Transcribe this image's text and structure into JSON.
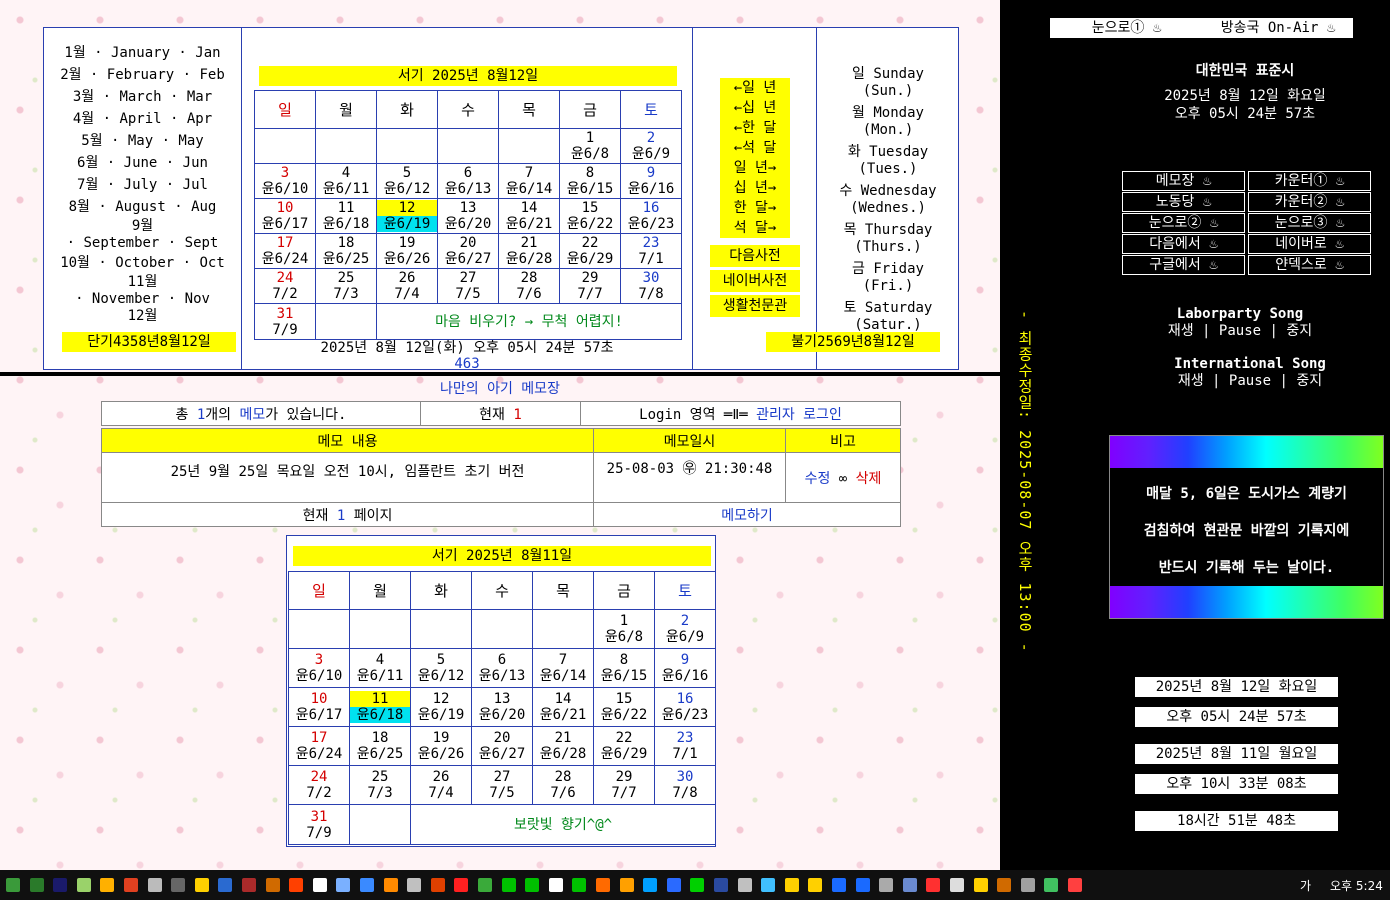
{
  "top": {
    "months": [
      "1월 · January · Jan",
      "2월 · February · Feb",
      "3월 · March · Mar",
      "4월 · April · Apr",
      "5월 · May · May",
      "6월 · June · Jun",
      "7월 · July · Jul",
      "8월 · August · Aug",
      "9월",
      "· September · Sept",
      "10월 · October · Oct",
      "11월",
      "· November · Nov",
      "12월"
    ],
    "dangi": "단기4358년8월12일",
    "bulgi": "불기2569년8월12일",
    "cal_title": "서기 2025년 8월12일",
    "weekday_headers": [
      "일",
      "월",
      "화",
      "수",
      "목",
      "금",
      "토"
    ],
    "rows": [
      [
        [
          "",
          ""
        ],
        [
          "",
          ""
        ],
        [
          "",
          ""
        ],
        [
          "",
          ""
        ],
        [
          "",
          ""
        ],
        [
          "1",
          "윤6/8"
        ],
        [
          "2",
          "윤6/9"
        ]
      ],
      [
        [
          "3",
          "윤6/10"
        ],
        [
          "4",
          "윤6/11"
        ],
        [
          "5",
          "윤6/12"
        ],
        [
          "6",
          "윤6/13"
        ],
        [
          "7",
          "윤6/14"
        ],
        [
          "8",
          "윤6/15"
        ],
        [
          "9",
          "윤6/16"
        ]
      ],
      [
        [
          "10",
          "윤6/17"
        ],
        [
          "11",
          "윤6/18"
        ],
        [
          "12",
          "윤6/19"
        ],
        [
          "13",
          "윤6/20"
        ],
        [
          "14",
          "윤6/21"
        ],
        [
          "15",
          "윤6/22"
        ],
        [
          "16",
          "윤6/23"
        ]
      ],
      [
        [
          "17",
          "윤6/24"
        ],
        [
          "18",
          "윤6/25"
        ],
        [
          "19",
          "윤6/26"
        ],
        [
          "20",
          "윤6/27"
        ],
        [
          "21",
          "윤6/28"
        ],
        [
          "22",
          "윤6/29"
        ],
        [
          "23",
          "7/1"
        ]
      ],
      [
        [
          "24",
          "7/2"
        ],
        [
          "25",
          "7/3"
        ],
        [
          "26",
          "7/4"
        ],
        [
          "27",
          "7/5"
        ],
        [
          "28",
          "7/6"
        ],
        [
          "29",
          "7/7"
        ],
        [
          "30",
          "7/8"
        ]
      ]
    ],
    "last_row_day": [
      "31",
      "7/9"
    ],
    "message": "마음 비우기? → 무척 어렵지!",
    "clock": "2025년 8월 12일(화) 오후 05시 24분 57초",
    "counter": "463",
    "nav": [
      "←일 년",
      "←십 년",
      "←한 달",
      "←석 달",
      "일 년→",
      "십 년→",
      "한 달→",
      "석 달→"
    ],
    "dict_buttons": [
      "다음사전",
      "네이버사전",
      "생활천문관"
    ],
    "days": [
      "일 Sunday",
      "(Sun.)",
      "월 Monday",
      "(Mon.)",
      "화 Tuesday",
      "(Tues.)",
      "수 Wednesday",
      "(Wednes.)",
      "목 Thursday",
      "(Thurs.)",
      "금 Friday",
      "(Fri.)",
      "토 Saturday",
      "(Satur.)"
    ]
  },
  "memo": {
    "title": "나만의 아기 메모장",
    "count_prefix": "총 ",
    "count": "1",
    "count_mid": "개의 ",
    "count_word": "메모",
    "count_suffix": "가 있습니다.",
    "current_label": "현재 ",
    "current": "1",
    "login_label": "Login 영역 ═Ⅱ═ ",
    "login_link": "관리자 로그인",
    "col_content": "메모 내용",
    "col_date": "메모일시",
    "col_note": "비고",
    "content": "25년 9월 25일 목요일 오전 10시, 임플란트 초기 버전",
    "date": "25-08-03 ㉾ 21:30:48",
    "edit": "수정",
    "sep": "∞",
    "delete": "삭제",
    "page_prefix": "현재 ",
    "page": "1",
    "page_suffix": " 페이지",
    "write": "메모하기"
  },
  "cal2": {
    "title": "서기 2025년 8월11일",
    "weekday_headers": [
      "일",
      "월",
      "화",
      "수",
      "목",
      "금",
      "토"
    ],
    "rows": [
      [
        [
          "",
          ""
        ],
        [
          "",
          ""
        ],
        [
          "",
          ""
        ],
        [
          "",
          ""
        ],
        [
          "",
          ""
        ],
        [
          "1",
          "윤6/8"
        ],
        [
          "2",
          "윤6/9"
        ]
      ],
      [
        [
          "3",
          "윤6/10"
        ],
        [
          "4",
          "윤6/11"
        ],
        [
          "5",
          "윤6/12"
        ],
        [
          "6",
          "윤6/13"
        ],
        [
          "7",
          "윤6/14"
        ],
        [
          "8",
          "윤6/15"
        ],
        [
          "9",
          "윤6/16"
        ]
      ],
      [
        [
          "10",
          "윤6/17"
        ],
        [
          "11",
          "윤6/18"
        ],
        [
          "12",
          "윤6/19"
        ],
        [
          "13",
          "윤6/20"
        ],
        [
          "14",
          "윤6/21"
        ],
        [
          "15",
          "윤6/22"
        ],
        [
          "16",
          "윤6/23"
        ]
      ],
      [
        [
          "17",
          "윤6/24"
        ],
        [
          "18",
          "윤6/25"
        ],
        [
          "19",
          "윤6/26"
        ],
        [
          "20",
          "윤6/27"
        ],
        [
          "21",
          "윤6/28"
        ],
        [
          "22",
          "윤6/29"
        ],
        [
          "23",
          "7/1"
        ]
      ],
      [
        [
          "24",
          "7/2"
        ],
        [
          "25",
          "7/3"
        ],
        [
          "26",
          "7/4"
        ],
        [
          "27",
          "7/5"
        ],
        [
          "28",
          "7/6"
        ],
        [
          "29",
          "7/7"
        ],
        [
          "30",
          "7/8"
        ]
      ]
    ],
    "last_row_day": [
      "31",
      "7/9"
    ],
    "message": "보랏빛 향기^@^"
  },
  "sidebar": {
    "tab1": "눈으로① ♨",
    "tab2": "방송국 On-Air ♨",
    "std_time": "대한민국 표준시",
    "date": "2025년 8월 12일 화요일",
    "time": "오후 05시 24분 57초",
    "links": [
      "메모장 ♨",
      "카운터① ♨",
      "노동당 ♨",
      "카운터② ♨",
      "눈으로② ♨",
      "눈으로③ ♨",
      "다음에서 ♨",
      "네이버로 ♨",
      "구글에서 ♨",
      "얀덱스로 ♨"
    ],
    "song1_title": "Laborparty Song",
    "song2_title": "International Song",
    "play": "재생",
    "pause": "Pause",
    "stop": "중지",
    "bar": "|",
    "notice": [
      "매달 5, 6일은 도시가스 계량기",
      "검침하여 현관문 바깥의 기록지에",
      "반드시 기록해 두는 날이다."
    ],
    "modified": "- 최종수정일: 2025-08-07 오후 13:00 -",
    "box1": "2025년 8월 12일 화요일",
    "box2": "오후 05시 24분 57초",
    "box3": "2025년 8월 11일 월요일",
    "box4": "오후 10시 33분 08초",
    "box5": "18시간 51분 48초"
  },
  "taskbar": {
    "ime": "가",
    "clock": "오후 5:24",
    "icon_colors": [
      "#3a9a3a",
      "#2a7a2a",
      "#1a1a6a",
      "#9ad26a",
      "#ffb000",
      "#e04020",
      "#bbbbbb",
      "#666666",
      "#ffd000",
      "#2a6ad0",
      "#aa2a2a",
      "#d06a00",
      "#ff4000",
      "#ffffff",
      "#7ab0ff",
      "#3a8aff",
      "#ff8a00",
      "#c0c0c0",
      "#e04000",
      "#ff2020",
      "#3aaa3a",
      "#00c000",
      "#00c000",
      "#ffffff",
      "#00c000",
      "#ff6a00",
      "#ffa000",
      "#00a0ff",
      "#2a6aff",
      "#00d000",
      "#2a4aa0",
      "#c0c0c0",
      "#40c0ff",
      "#ffd000",
      "#ffd000",
      "#1a6aff",
      "#1a6aff",
      "#aaaaaa",
      "#6a8ad0",
      "#ff3030",
      "#dddddd",
      "#ffd000",
      "#d06a00",
      "#a0a0a0",
      "#40c060",
      "#ff4040"
    ]
  }
}
